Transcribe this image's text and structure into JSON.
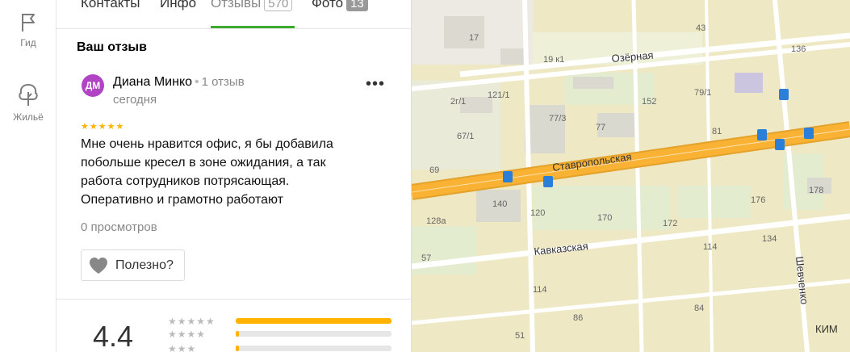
{
  "sidebar": {
    "guide_label": "Гид",
    "housing_label": "Жильё"
  },
  "tabs": {
    "contacts": "Контакты",
    "info": "Инфо",
    "reviews": "Отзывы",
    "reviews_count": "570",
    "photo": "Фото",
    "photo_count": "13",
    "active": "reviews"
  },
  "review": {
    "section_title": "Ваш отзыв",
    "avatar_initials": "ДМ",
    "author": "Диана Минко",
    "separator": "•",
    "author_reviews": "1 отзыв",
    "date": "сегодня",
    "stars": "★★★★★",
    "rating": 5,
    "text": "Мне очень нравится офис, я бы добавила побольше кресел в зоне ожидания, а так работа сотрудников потрясающая. Оперативно и грамотно работают",
    "views": "0 просмотров",
    "useful_label": "Полезно?",
    "more_icon": "more-dots-icon"
  },
  "summary": {
    "rating_value": "4.4",
    "rows": [
      {
        "stars": "★★★★★",
        "fill": 1.0
      },
      {
        "stars": "★★★★",
        "fill": 0.02
      },
      {
        "stars": "★★★",
        "fill": 0.02
      }
    ]
  },
  "map": {
    "streets": {
      "stavropolskaya": "Ставропольская",
      "ozernaya": "Озёрная",
      "kavkazskaya": "Кавказская",
      "shevchenko": "Шевченко",
      "kim": "КИМ"
    },
    "house_numbers": [
      "17",
      "19 к1",
      "43",
      "136",
      "2г/1",
      "121/1",
      "152",
      "79/1",
      "77/3",
      "77",
      "81",
      "67/1",
      "69",
      "140",
      "120",
      "170",
      "172",
      "176",
      "178",
      "128а",
      "134",
      "114",
      "57",
      "114",
      "86",
      "51",
      "84"
    ],
    "colors": {
      "background": "#efe8c4",
      "main_road": "#f9b233",
      "road": "#ffffff",
      "transit": "#2b7fd8"
    }
  }
}
